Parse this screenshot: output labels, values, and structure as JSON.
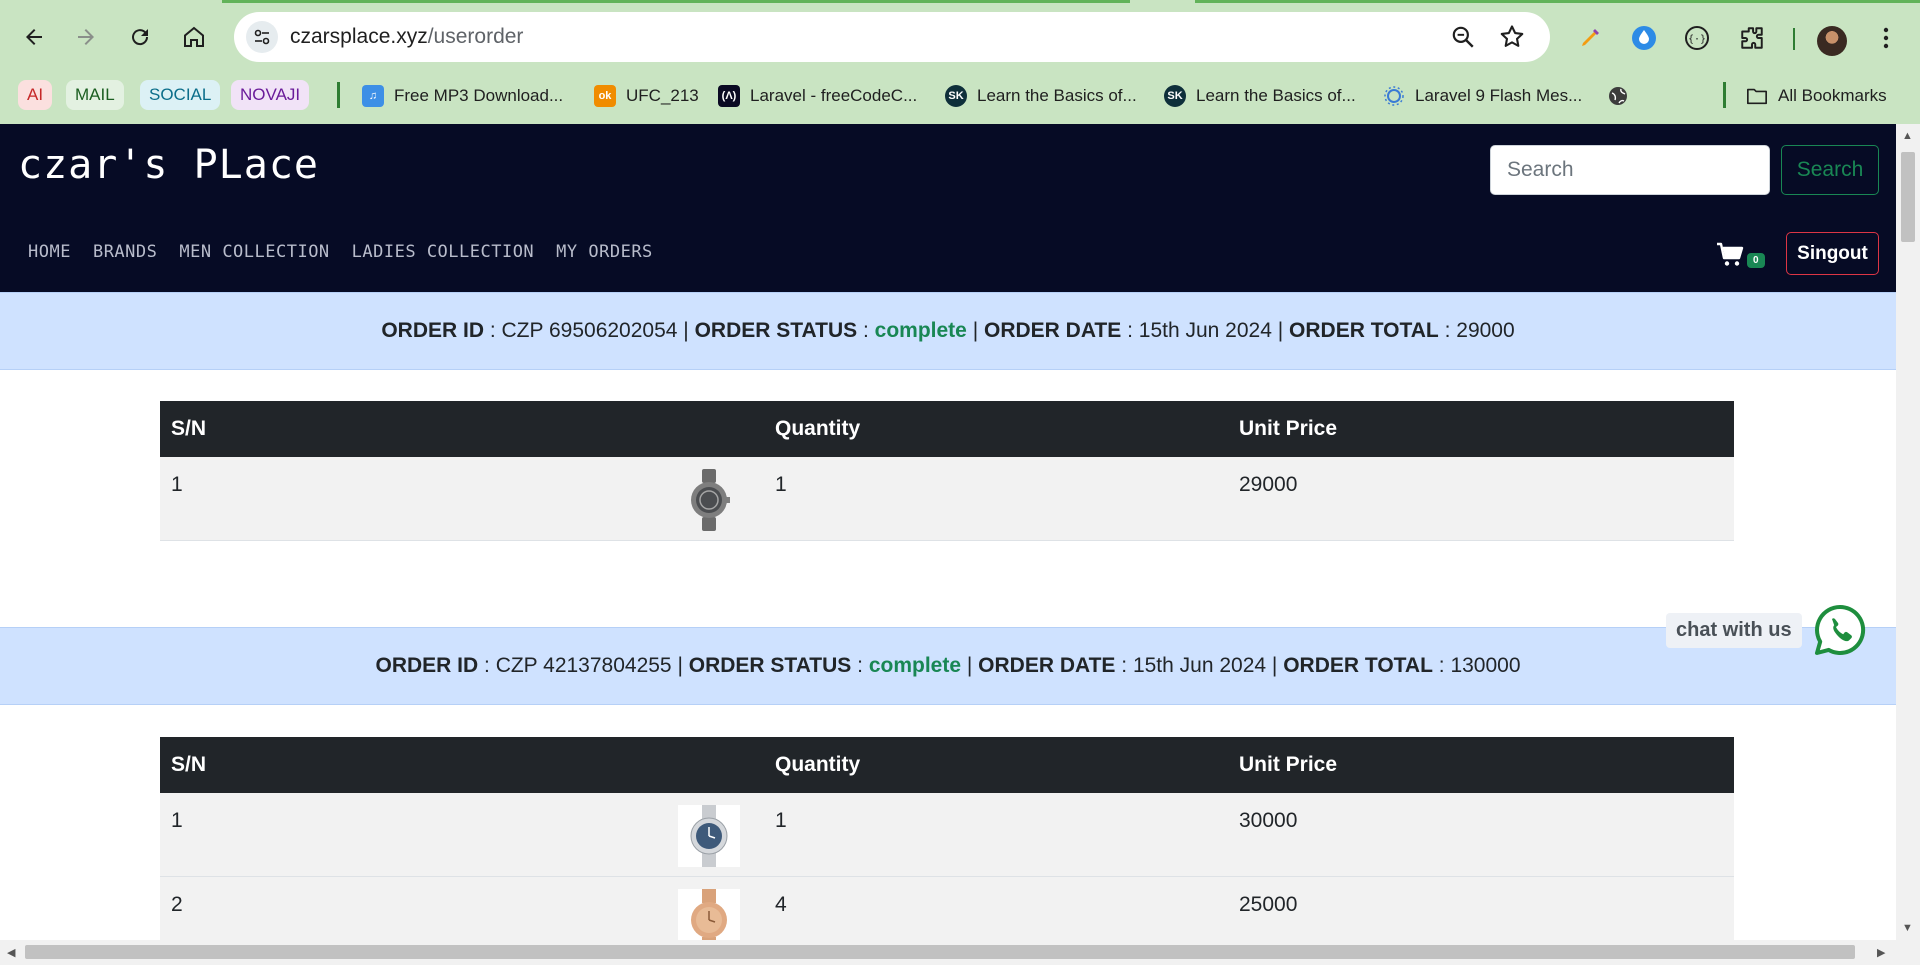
{
  "browser": {
    "url_host": "czarsplace.xyz",
    "url_path": "/userorder",
    "bookmark_chips": [
      {
        "label": "AI",
        "color": "#c62828",
        "bg": "#fbe0df"
      },
      {
        "label": "MAIL",
        "color": "#1b5e20",
        "bg": "#e3f1e1"
      },
      {
        "label": "SOCIAL",
        "color": "#0b6e8a",
        "bg": "#dcf1f5"
      },
      {
        "label": "NOVAJI",
        "color": "#6a1b9a",
        "bg": "#f1e3f7"
      }
    ],
    "bookmarks": [
      {
        "label": "Free MP3 Download...",
        "icon": "music-note-icon"
      },
      {
        "label": "UFC_213",
        "icon": "ok-icon"
      },
      {
        "label": "Laravel - freeCodeC...",
        "icon": "freecodecamp-icon"
      },
      {
        "label": "Learn the Basics of...",
        "icon": "sk-icon"
      },
      {
        "label": "Learn the Basics of...",
        "icon": "sk-icon"
      },
      {
        "label": "Laravel 9 Flash Mes...",
        "icon": "gear-bulb-icon"
      },
      {
        "label": "",
        "icon": "globe-icon"
      }
    ],
    "all_bookmarks_label": "All Bookmarks"
  },
  "site": {
    "brand": "czar's PLace",
    "search": {
      "placeholder": "Search",
      "button_label": "Search"
    },
    "nav": [
      "HOME",
      "BRANDS",
      "MEN COLLECTION",
      "LADIES COLLECTION",
      "MY ORDERS"
    ],
    "cart_count": "0",
    "signout_label": "Singout"
  },
  "labels": {
    "order_id": "ORDER ID",
    "order_status": "ORDER STATUS",
    "order_date": "ORDER DATE",
    "order_total": "ORDER TOTAL",
    "sep_colon": " : ",
    "sep_bar": " | "
  },
  "table_headers": {
    "sn": "S/N",
    "image": "",
    "quantity": "Quantity",
    "unit_price": "Unit Price"
  },
  "orders": [
    {
      "id": "CZP 69506202054",
      "status": "complete",
      "date": "15th Jun 2024",
      "total": "29000",
      "items": [
        {
          "sn": "1",
          "image": "grey-watch",
          "quantity": "1",
          "unit_price": "29000"
        }
      ]
    },
    {
      "id": "CZP 42137804255",
      "status": "complete",
      "date": "15th Jun 2024",
      "total": "130000",
      "items": [
        {
          "sn": "1",
          "image": "silver-blue-watch",
          "quantity": "1",
          "unit_price": "30000"
        },
        {
          "sn": "2",
          "image": "rose-gold-watch",
          "quantity": "4",
          "unit_price": "25000"
        }
      ]
    }
  ],
  "chat": {
    "label": "chat with us"
  },
  "colors": {
    "header_bg": "#060b25",
    "order_bar_bg": "#cfe2ff",
    "status_green": "#198754",
    "table_head_bg": "#212529",
    "signout_border": "#dc3545"
  }
}
